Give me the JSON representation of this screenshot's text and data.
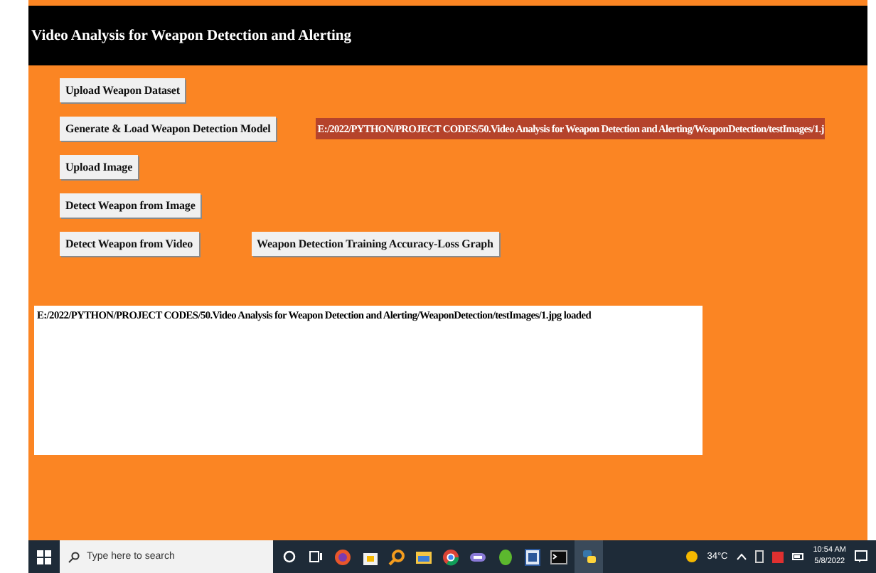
{
  "window": {
    "title": "Video Analysis for Weapon Detection and Alerting"
  },
  "buttons_left": [
    {
      "label": "Upload Weapon Dataset"
    },
    {
      "label": "Generate & Load Weapon Detection Model"
    },
    {
      "label": "Upload Image"
    },
    {
      "label": "Detect Weapon from Image"
    },
    {
      "label": "Detect Weapon from Video"
    }
  ],
  "graph_button": {
    "label": "Weapon Detection Training Accuracy-Loss Graph"
  },
  "path_label": "E:/2022/PYTHON/PROJECT CODES/50.Video Analysis for Weapon Detection and Alerting/WeaponDetection/testImages/1.j",
  "output_text": "E:/2022/PYTHON/PROJECT CODES/50.Video Analysis for Weapon Detection and Alerting/WeaponDetection/testImages/1.jpg loaded",
  "taskbar": {
    "search_placeholder": "Type here to search",
    "apps": [
      {
        "kind": "cortana"
      },
      {
        "kind": "taskview"
      },
      {
        "kind": "firefox"
      },
      {
        "kind": "store"
      },
      {
        "kind": "search"
      },
      {
        "kind": "files"
      },
      {
        "kind": "chrome"
      },
      {
        "kind": "app"
      },
      {
        "kind": "leaf"
      },
      {
        "kind": "word"
      },
      {
        "kind": "terminal"
      },
      {
        "kind": "python"
      }
    ],
    "weather": "34°C",
    "time": "10:54 AM",
    "date": "5/8/2022"
  }
}
